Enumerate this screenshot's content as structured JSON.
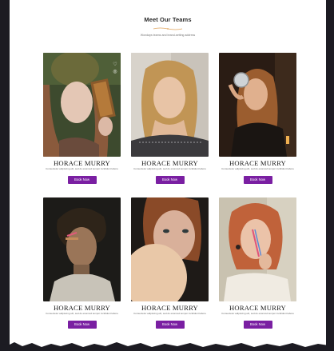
{
  "section": {
    "title": "Meet Our Teams",
    "subtitle": "Wondays teams and brand-setting address"
  },
  "members": [
    {
      "name": "HORACE MURRY",
      "description": "Consectetur adipiscing elit, sed do eiusmod tempor incididunt labore",
      "button": "Book Now"
    },
    {
      "name": "HORACE MURRY",
      "description": "Consectetur adipiscing elit, sed do eiusmod tempor incididunt labore",
      "button": "Book Now"
    },
    {
      "name": "HORACE MURRY",
      "description": "Consectetur adipiscing elit, sed do eiusmod tempor incididunt labore",
      "button": "Book Now"
    },
    {
      "name": "HORACE MURRY",
      "description": "Consectetur adipiscing elit, sed do eiusmod tempor incididunt labore",
      "button": "Book Now"
    },
    {
      "name": "HORACE MURRY",
      "description": "Consectetur adipiscing elit, sed do eiusmod tempor incididunt labore",
      "button": "Book Now"
    },
    {
      "name": "HORACE MURRY",
      "description": "Consectetur adipiscing elit, sed do eiusmod tempor incididunt labore",
      "button": "Book Now"
    }
  ],
  "colors": {
    "accent": "#7a1fa2",
    "divider": "#e0a35a",
    "frame": "#1c1b22"
  },
  "icons": [
    "twitter-icon",
    "instagram-icon"
  ]
}
